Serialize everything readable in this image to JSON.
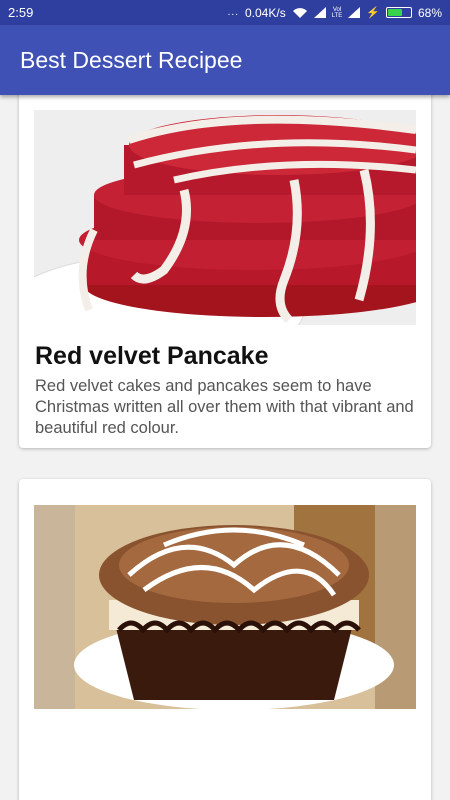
{
  "status": {
    "time": "2:59",
    "dots": "...",
    "speed": "0.04K/s",
    "battery": "68%",
    "battery_level": 0.68
  },
  "appbar": {
    "title": "Best Dessert Recipee"
  },
  "recipes": [
    {
      "title": "Red velvet Pancake",
      "description": "Red velvet cakes and pancakes seem to have Christmas written all over them with that vibrant and beautiful red colour."
    },
    {
      "title": "",
      "description": ""
    }
  ],
  "colors": {
    "status_bar": "#2f3f9f",
    "app_bar": "#3f51b5",
    "background": "#f2f2f2"
  }
}
